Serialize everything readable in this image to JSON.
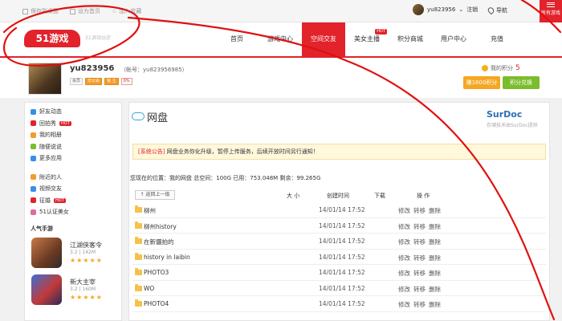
{
  "topbar": {
    "links": [
      "保存到桌面",
      "设为首页",
      "加入收藏"
    ],
    "username": "yu823956",
    "logout": "注销",
    "navigation": "导航",
    "more_games": "所有游戏"
  },
  "header": {
    "logo_text": "51游戏",
    "logo_sub": "51游戏社区",
    "nav": [
      {
        "label": "首页",
        "hot": false
      },
      {
        "label": "游戏中心",
        "hot": false
      },
      {
        "label": "空间交友",
        "hot": false,
        "active": true
      },
      {
        "label": "美女主播",
        "hot": true
      },
      {
        "label": "积分商城",
        "hot": false
      },
      {
        "label": "用户中心",
        "hot": false
      },
      {
        "label": "充值",
        "hot": false
      }
    ],
    "hot_label": "HOT"
  },
  "profile": {
    "name": "yu823956",
    "account": "（帐号：yu823956985）",
    "badges": [
      "会员",
      "无公会",
      "铭 主",
      "0%"
    ],
    "points_label": "我的积分",
    "points_value": "5",
    "earn_button": "赚1600积分",
    "redeem_button": "积分兑换"
  },
  "sidebar": {
    "group1": [
      {
        "label": "好友动态",
        "color": "#3a8ee6",
        "hot": false
      },
      {
        "label": "回拍秀",
        "color": "#e2232b",
        "hot": true
      },
      {
        "label": "我的相册",
        "color": "#f39b2b",
        "hot": false
      },
      {
        "label": "随便说说",
        "color": "#7bbd2c",
        "hot": false
      },
      {
        "label": "更多应用",
        "color": "#3a8ee6",
        "hot": false
      }
    ],
    "group2": [
      {
        "label": "附近的人",
        "color": "#f39b2b",
        "hot": false
      },
      {
        "label": "视频交友",
        "color": "#3a8ee6",
        "hot": false
      },
      {
        "label": "征婚",
        "color": "#e2232b",
        "hot": true
      },
      {
        "label": "51认证美女",
        "color": "#e26aa0",
        "hot": false
      }
    ],
    "hot_label": "HOT",
    "games_title": "人气手游",
    "games": [
      {
        "name": "江湖侠客令",
        "meta": "3.2 | 142M",
        "stars": "★★★★★"
      },
      {
        "name": "新大主宰",
        "meta": "3.2 | 160M",
        "stars": "★★★★★"
      }
    ]
  },
  "main": {
    "title": "网盘",
    "brand": "SurDoc",
    "brand_sub": "存储技术由SurDoc提供",
    "notice_tag": "[系统公告]",
    "notice_text": "网盘业务你化升级，暂停上传服务，后续开放时间另行通知！",
    "location": "您现在的位置：我的网盘 总空间：100G 已用：753.048M 剩余：99.265G",
    "back_button": "返回上一级",
    "columns": {
      "size": "大 小",
      "created": "创建时间",
      "download": "下载",
      "action": "操 作"
    },
    "files": [
      {
        "name": "柳州",
        "date": "14/01/14 17:52"
      },
      {
        "name": "柳州history",
        "date": "14/01/14 17:52"
      },
      {
        "name": "在新疆拍的",
        "date": "14/01/14 17:52"
      },
      {
        "name": "history in laibin",
        "date": "14/01/14 17:52"
      },
      {
        "name": "PHOTO3",
        "date": "14/01/14 17:52"
      },
      {
        "name": "WO",
        "date": "14/01/14 17:52"
      },
      {
        "name": "PHOTO4",
        "date": "14/01/14 17:52"
      }
    ],
    "ops": [
      "修改",
      "转移",
      "删除"
    ]
  },
  "colors": {
    "accent": "#e2232b",
    "scribble": "#e01010"
  }
}
